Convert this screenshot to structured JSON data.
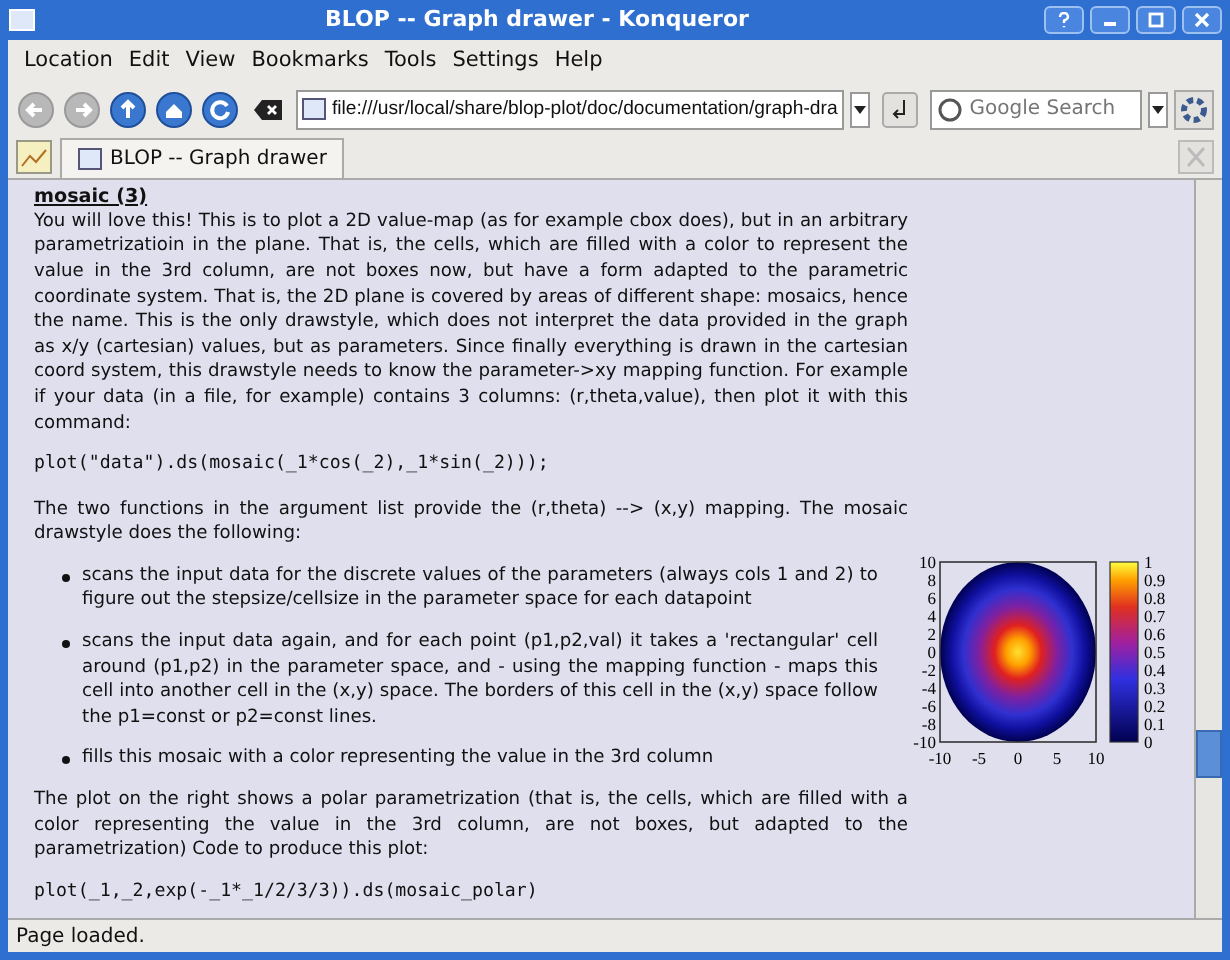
{
  "window": {
    "title": "BLOP -- Graph drawer - Konqueror"
  },
  "menu": [
    "Location",
    "Edit",
    "View",
    "Bookmarks",
    "Tools",
    "Settings",
    "Help"
  ],
  "toolbar": {
    "buttons": [
      {
        "kind": "back",
        "disabled": true
      },
      {
        "kind": "forward",
        "disabled": true
      },
      {
        "kind": "up",
        "disabled": false
      },
      {
        "kind": "home",
        "disabled": false
      },
      {
        "kind": "reload",
        "disabled": false
      }
    ],
    "location": "file:///usr/local/share/blop-plot/doc/documentation/graph-dra",
    "search": {
      "placeholder": "Google Search"
    }
  },
  "tabs": [
    {
      "label": "BLOP -- Graph drawer",
      "selected": true
    }
  ],
  "content": {
    "heading": "mosaic (3)",
    "intro": "You will love this! This is to plot a 2D value-map (as for example cbox does), but in an arbitrary parametrizatioin in the plane. That is, the cells, which are filled with a color to represent the value in the 3rd column, are not boxes now, but have a form adapted to the parametric coordinate system. That is, the 2D plane is covered by areas of different shape: mosaics, hence the name. This is the only drawstyle, which does not interpret the data provided in the graph as x/y (cartesian) values, but as parameters. Since finally everything is drawn in the cartesian coord system, this drawstyle needs to know the parameter->xy mapping function. For example if your data (in a file, for example) contains 3 columns: (r,theta,value), then plot it with this command:",
    "code_1": "plot(\"data\").ds(mosaic(_1*cos(_2),_1*sin(_2)));",
    "para_2": "The two functions in the argument list provide the (r,theta) --> (x,y) mapping. The mosaic drawstyle does the following:",
    "bullets": [
      "scans the input data for the discrete values of the parameters (always cols 1 and 2) to figure out the stepsize/cellsize in the parameter space for each datapoint",
      "scans the input data again, and for each point (p1,p2,val) it takes a 'rectangular' cell around (p1,p2) in the parameter space, and - using the mapping function - maps this cell into another cell in the (x,y) space. The borders of this cell in the (x,y) space follow the p1=const or p2=const lines.",
      "fills this mosaic with a color representing the value in the 3rd column"
    ],
    "para_3": "The plot on the right shows a polar parametrization (that is, the cells, which are filled with a color representing the value in the 3rd column, are not boxes, but adapted to the parametrization) Code to produce this plot:",
    "code_2": "plot(_1,_2,exp(-_1*_1/2/3/3)).ds(mosaic_polar)",
    "plot": {
      "x_ticks": [
        "-10",
        "-5",
        "0",
        "5",
        "10"
      ],
      "y_ticks": [
        "10",
        "8",
        "6",
        "4",
        "2",
        "0",
        "-2",
        "-4",
        "-6",
        "-8",
        "-10"
      ],
      "colorbar_ticks": [
        "1",
        "0.9",
        "0.8",
        "0.7",
        "0.6",
        "0.5",
        "0.4",
        "0.3",
        "0.2",
        "0.1",
        "0"
      ]
    }
  },
  "status_bar": "Page loaded."
}
